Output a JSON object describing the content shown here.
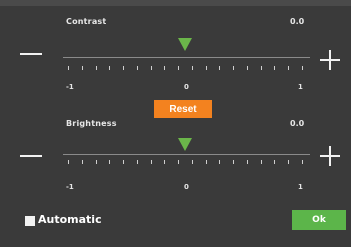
{
  "contrast": {
    "label": "Contrast",
    "value_text": "0.0",
    "value": 0.0,
    "min_label": "-1",
    "mid_label": "0",
    "max_label": "1"
  },
  "brightness": {
    "label": "Brightness",
    "value_text": "0.0",
    "value": 0.0,
    "min_label": "-1",
    "mid_label": "0",
    "max_label": "1"
  },
  "reset_label": "Reset",
  "automatic": {
    "label": "Automatic",
    "checked": false
  },
  "ok_label": "Ok",
  "colors": {
    "background": "#3a3a3a",
    "thumb": "#6bb64a",
    "reset": "#f3821f",
    "ok": "#5cb54a"
  },
  "icons": {
    "decrease": "minus-icon",
    "increase": "plus-icon"
  }
}
